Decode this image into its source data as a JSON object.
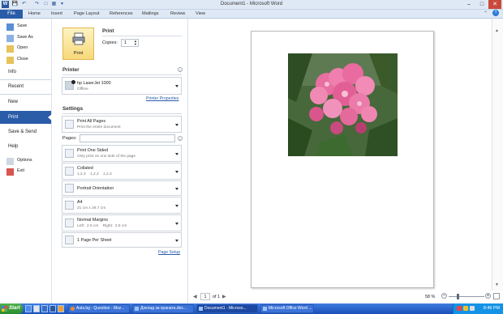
{
  "window": {
    "title": "Document1 - Microsoft Word"
  },
  "ribbon": {
    "tabs": [
      "File",
      "Home",
      "Insert",
      "Page Layout",
      "References",
      "Mailings",
      "Review",
      "View"
    ]
  },
  "nav": {
    "save": "Save",
    "save_as": "Save As",
    "open": "Open",
    "close": "Close",
    "info": "Info",
    "recent": "Recent",
    "new": "New",
    "print": "Print",
    "save_send": "Save & Send",
    "help": "Help",
    "options": "Options",
    "exit": "Exit"
  },
  "print": {
    "section_title": "Print",
    "button_label": "Print",
    "copies_label": "Copies:",
    "copies_value": "1"
  },
  "printer": {
    "section_title": "Printer",
    "name": "hp LaserJet 1000",
    "status": "Offline",
    "properties_link": "Printer Properties"
  },
  "settings": {
    "section_title": "Settings",
    "pages_label": "Pages:",
    "pages_value": "",
    "dropdowns": [
      {
        "line1": "Print All Pages",
        "line2": "Print the entire document"
      },
      {
        "line1": "Print One Sided",
        "line2": "Only print on one side of the page"
      },
      {
        "line1": "Collated",
        "line2": "1,2,3    1,2,3    1,2,3"
      },
      {
        "line1": "Portrait Orientation",
        "line2": ""
      },
      {
        "line1": "A4",
        "line2": "21 cm x 29.7 cm"
      },
      {
        "line1": "Normal Margins",
        "line2": "Left:  2.5 cm    Right:  2.5 cm"
      },
      {
        "line1": "1 Page Per Sheet",
        "line2": ""
      }
    ],
    "page_setup_link": "Page Setup"
  },
  "preview": {
    "page_current": "1",
    "page_of": "of 1",
    "zoom": "58 %"
  },
  "taskbar": {
    "start": "Start",
    "buttons": [
      "Aula.bg - Question - Moz...",
      "Доклад за храната.doc...",
      "Document1 - Microso...",
      "Microsoft Office Word ..."
    ],
    "clock": "8:46 PM"
  },
  "colors": {
    "accent": "#2a5ca8",
    "taskbar": "#245edb",
    "start": "#3c9a3c"
  }
}
